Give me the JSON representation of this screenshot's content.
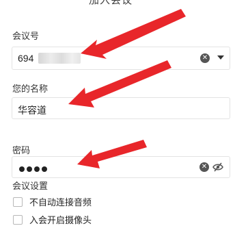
{
  "window": {
    "title": "加入会议"
  },
  "meeting_id": {
    "label": "会议号",
    "value": "694"
  },
  "name": {
    "label": "您的名称",
    "value": "华容道"
  },
  "password": {
    "label": "密码",
    "masked_length": 4
  },
  "settings": {
    "label": "会议设置",
    "options": [
      {
        "label": "不自动连接音频",
        "checked": false
      },
      {
        "label": "入会开启摄像头",
        "checked": false
      }
    ]
  },
  "annotation_color": "#e8262a"
}
